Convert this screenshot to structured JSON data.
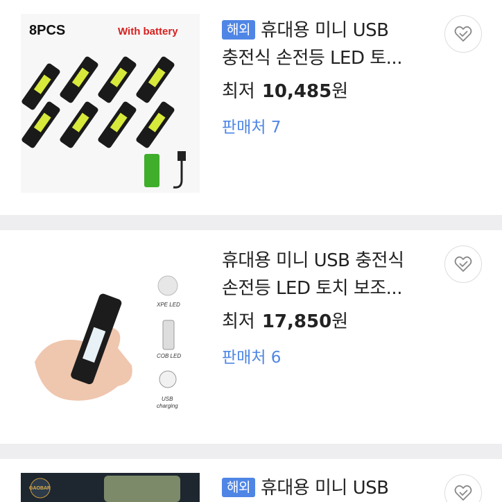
{
  "products": [
    {
      "badge": "해외",
      "title_line1": "휴대용 미니 USB",
      "title_line2": "충전식 손전등 LED 토...",
      "price_label": "최저",
      "price": "10,485",
      "currency": "원",
      "seller": "판매처 7",
      "image_text_left": "8PCS",
      "image_text_right": "With battery",
      "favorite_icon": "heart-check-icon"
    },
    {
      "badge": "",
      "title_line1": "휴대용 미니 USB 충전식",
      "title_line2": "손전등 LED 토치 보조...",
      "price_label": "최저",
      "price": "17,850",
      "currency": "원",
      "seller": "판매처 6",
      "image_labels": [
        "XPE LED",
        "COB LED",
        "USB",
        "charging"
      ],
      "favorite_icon": "heart-check-icon"
    },
    {
      "badge": "해외",
      "title_line1": "휴대용 미니 USB",
      "image_text_logo": "GAOBAR",
      "favorite_icon": "heart-check-icon"
    }
  ],
  "colors": {
    "accent": "#4f86e5",
    "separator": "#eeeef0"
  }
}
